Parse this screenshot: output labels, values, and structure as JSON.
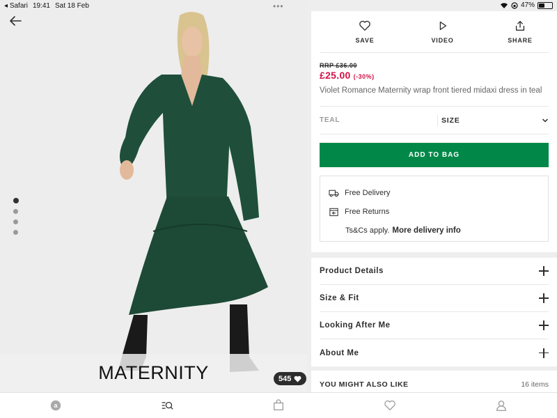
{
  "statusbar": {
    "app": "Safari",
    "time": "19:41",
    "date": "Sat 18 Feb",
    "battery": "47%",
    "battery_level": 0.47,
    "more": "•••"
  },
  "image": {
    "banner": "MATERNITY",
    "likes": "545",
    "slide_count": 4,
    "active_slide": 1
  },
  "actions": {
    "save": "SAVE",
    "video": "VIDEO",
    "share": "SHARE"
  },
  "product": {
    "rrp": "RRP £36.00",
    "price": "£25.00",
    "discount": "(-30%)",
    "name": "Violet Romance Maternity wrap front tiered midaxi dress in teal",
    "colour": "TEAL",
    "size_label": "SIZE",
    "add_to_bag": "ADD TO BAG"
  },
  "delivery": {
    "free_delivery": "Free Delivery",
    "free_returns": "Free Returns",
    "tcs": "Ts&Cs apply.",
    "more_info": "More delivery info"
  },
  "accordion": [
    {
      "label": "Product Details"
    },
    {
      "label": "Size & Fit"
    },
    {
      "label": "Looking After Me"
    },
    {
      "label": "About Me"
    }
  ],
  "also_like": {
    "title": "YOU MIGHT ALSO LIKE",
    "count": "16 items"
  },
  "colors": {
    "price": "#d01345",
    "add_to_bag": "#018849",
    "dress": "#1f4f3a"
  },
  "tabbar": [
    "home-icon",
    "search-icon",
    "bag-icon",
    "saved-icon",
    "account-icon"
  ]
}
